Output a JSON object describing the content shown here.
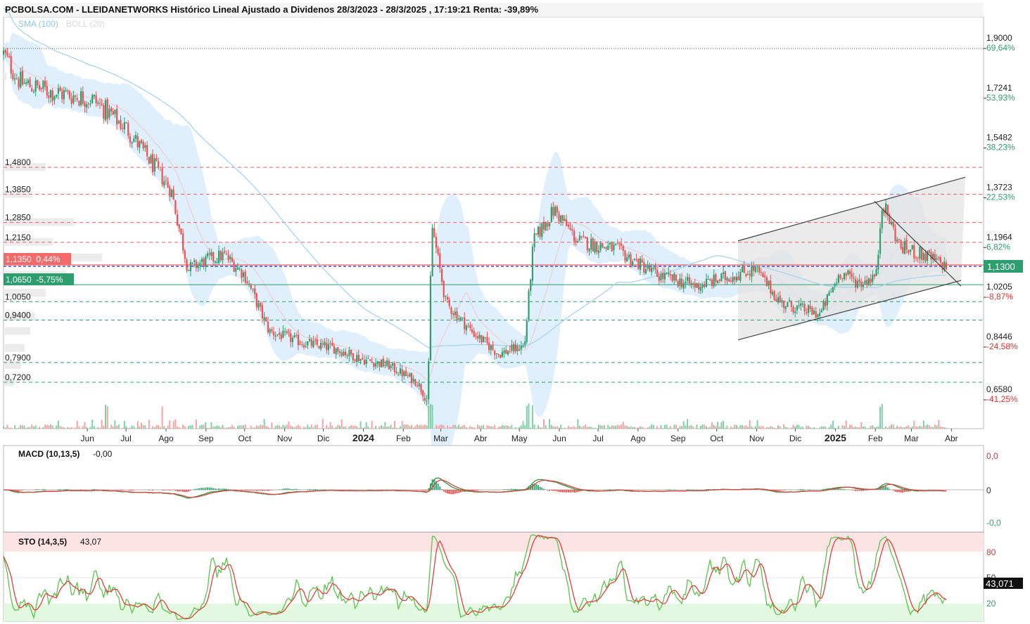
{
  "header": {
    "title": "PCBOLSA.COM - LLEIDANETWORKS Histórico Lineal Ajustado a Dividenos 28/3/2023 - 28/3/2025 , 17:19:21 Renta: -39,89%",
    "legend_sma": "SMA (100)",
    "legend_boll": "BOLL (20)"
  },
  "colors": {
    "up": "#2e9e6e",
    "down": "#f0514f",
    "sma": "#a7d3f0",
    "boll_fill": "#d4eaf9",
    "channel_fill": "#e6e6e6",
    "resistance": "#f06060",
    "support": "#2e9e6e",
    "last_price": "#2e9e6e"
  },
  "price_panel": {
    "right_levels": [
      {
        "price": "1,9000",
        "pct": "69,64%",
        "pct_color": "green"
      },
      {
        "price": "1,7241",
        "pct": "53,93%",
        "pct_color": "green"
      },
      {
        "price": "1,5482",
        "pct": "38,23%",
        "pct_color": "green"
      },
      {
        "price": "1,3723",
        "pct": "22,53%",
        "pct_color": "green"
      },
      {
        "price": "1,1964",
        "pct": "6,82%",
        "pct_color": "green"
      },
      {
        "price": "1,0205",
        "pct": "-8,87%",
        "pct_color": "red"
      },
      {
        "price": "0,8446",
        "pct": "-24,58%",
        "pct_color": "red"
      },
      {
        "price": "0,6580",
        "pct": "-41,25%",
        "pct_color": "red"
      }
    ],
    "left_levels": [
      "1,4800",
      "1,3850",
      "1,2850",
      "1,2150",
      "1,0050",
      "0,9400",
      "0,7900",
      "0,7200"
    ],
    "tag_red": "1,1350  0,44%",
    "tag_green": "1,0650  -5,75%",
    "last_price": "1,1300"
  },
  "x_axis": [
    "Jun",
    "Jul",
    "Ago",
    "Sep",
    "Oct",
    "Nov",
    "Dic",
    "2024",
    "Feb",
    "Mar",
    "Abr",
    "May",
    "Jun",
    "Jul",
    "Ago",
    "Sep",
    "Oct",
    "Nov",
    "Dic",
    "2025",
    "Feb",
    "Mar",
    "Abr"
  ],
  "macd_panel": {
    "label": "MACD (10,13,5)",
    "value": "-0,00",
    "top_tick": "0,0",
    "mid_tick": "0",
    "bottom_tick": "-0,0"
  },
  "sto_panel": {
    "label": "STO (14,3,5)",
    "value": "43,07",
    "tick_80": "80",
    "tick_50": "50",
    "tick_20": "20",
    "last_value": "43,071"
  },
  "chart_data": {
    "type": "candlestick",
    "title": "LLEIDANETWORKS Histórico Lineal Ajustado a Dividenos 28/3/2023 - 28/3/2025",
    "y_range": [
      0.6,
      1.96
    ],
    "price_path": [
      {
        "x": "2023-03-28",
        "y": 1.88
      },
      {
        "x": "2023-04-10",
        "y": 1.78
      },
      {
        "x": "2023-05-01",
        "y": 1.75
      },
      {
        "x": "2023-06-05",
        "y": 1.72
      },
      {
        "x": "2023-07-01",
        "y": 1.62
      },
      {
        "x": "2023-07-20",
        "y": 1.5
      },
      {
        "x": "2023-08-05",
        "y": 1.4
      },
      {
        "x": "2023-08-18",
        "y": 1.12
      },
      {
        "x": "2023-09-01",
        "y": 1.15
      },
      {
        "x": "2023-09-15",
        "y": 1.17
      },
      {
        "x": "2023-10-01",
        "y": 1.1
      },
      {
        "x": "2023-10-20",
        "y": 0.9
      },
      {
        "x": "2023-11-15",
        "y": 0.86
      },
      {
        "x": "2023-12-10",
        "y": 0.84
      },
      {
        "x": "2024-01-01",
        "y": 0.8
      },
      {
        "x": "2024-01-20",
        "y": 0.78
      },
      {
        "x": "2024-02-12",
        "y": 0.72
      },
      {
        "x": "2024-02-20",
        "y": 0.65
      },
      {
        "x": "2024-02-23",
        "y": 1.28
      },
      {
        "x": "2024-03-05",
        "y": 1.0
      },
      {
        "x": "2024-03-25",
        "y": 0.9
      },
      {
        "x": "2024-04-15",
        "y": 0.82
      },
      {
        "x": "2024-05-05",
        "y": 0.85
      },
      {
        "x": "2024-05-12",
        "y": 1.22
      },
      {
        "x": "2024-05-28",
        "y": 1.33
      },
      {
        "x": "2024-06-15",
        "y": 1.22
      },
      {
        "x": "2024-07-15",
        "y": 1.19
      },
      {
        "x": "2024-08-15",
        "y": 1.1
      },
      {
        "x": "2024-09-15",
        "y": 1.06
      },
      {
        "x": "2024-10-15",
        "y": 1.1
      },
      {
        "x": "2024-10-31",
        "y": 1.12
      },
      {
        "x": "2024-11-20",
        "y": 1.0
      },
      {
        "x": "2024-12-20",
        "y": 0.96
      },
      {
        "x": "2025-01-05",
        "y": 1.11
      },
      {
        "x": "2025-01-20",
        "y": 1.07
      },
      {
        "x": "2025-02-02",
        "y": 1.1
      },
      {
        "x": "2025-02-06",
        "y": 1.36
      },
      {
        "x": "2025-02-20",
        "y": 1.2
      },
      {
        "x": "2025-03-15",
        "y": 1.16
      },
      {
        "x": "2025-03-28",
        "y": 1.13
      }
    ],
    "horizontal_levels": {
      "resistance": [
        1.48,
        1.385,
        1.285,
        1.215
      ],
      "support": [
        1.065,
        1.005,
        0.94,
        0.79,
        0.72
      ],
      "reference": 1.9
    },
    "last_price": 1.13
  }
}
